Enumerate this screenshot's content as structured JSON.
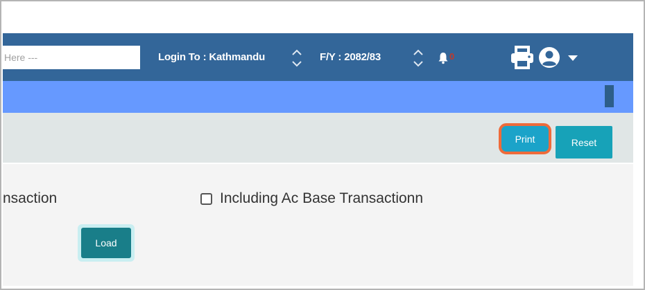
{
  "header": {
    "search": {
      "placeholder": "Here ---",
      "value": ""
    },
    "login_label": "Login To : Kathmandu",
    "fiscal_year_label": "F/Y : 2082/83",
    "notification_count": "0"
  },
  "icons": {
    "login_selector": "up-down-chevron-icon",
    "fy_selector": "up-down-chevron-icon",
    "notifications": "bell-icon",
    "print": "printer-icon",
    "user": "user-circle-icon",
    "menu": "caret-down-icon"
  },
  "toolbar": {
    "print_label": "Print",
    "reset_label": "Reset"
  },
  "options": {
    "transaction_label": "nsaction",
    "ac_base_label": "Including Ac Base Transactionn",
    "ac_base_checked": false
  },
  "form": {
    "load_label": "Load"
  },
  "colors": {
    "topbar": "#336699",
    "subbar": "#6699ff",
    "button": "#17a2b8",
    "highlight": "#ee6b3a",
    "load": "#197e89"
  }
}
